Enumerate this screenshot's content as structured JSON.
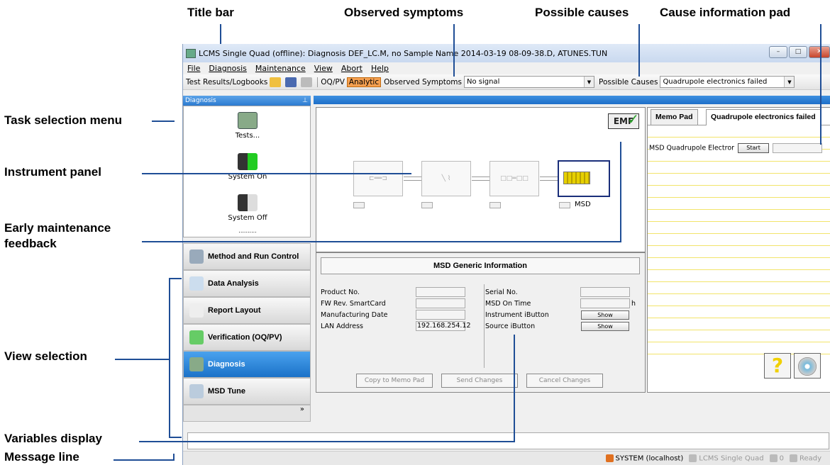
{
  "callouts": {
    "title_bar": "Title bar",
    "observed_symptoms": "Observed symptoms",
    "possible_causes": "Possible causes",
    "cause_info_pad": "Cause information pad",
    "task_selection_menu": "Task selection menu",
    "instrument_panel": "Instrument panel",
    "early_maintenance_1": "Early maintenance",
    "early_maintenance_2": "feedback",
    "view_selection": "View selection",
    "variables_display": "Variables display",
    "message_line": "Message line"
  },
  "window": {
    "title": "LCMS Single Quad (offline): Diagnosis DEF_LC.M, no Sample Name 2014-03-19 08-09-38.D, ATUNES.TUN"
  },
  "menu": [
    "File",
    "Diagnosis",
    "Maintenance",
    "View",
    "Abort",
    "Help"
  ],
  "toolbar": {
    "test_results": "Test Results/Logbooks",
    "oqpv": "OQ/PV",
    "analytic": "Analytic",
    "observed_symptoms_label": "Observed Symptoms",
    "observed_symptoms_value": "No signal",
    "possible_causes_label": "Possible Causes",
    "possible_causes_value": "Quadrupole electronics failed"
  },
  "left": {
    "header": "Diagnosis",
    "tasks": [
      "Tests...",
      "System On",
      "System Off"
    ],
    "dots": "..........",
    "views": [
      "Method and Run Control",
      "Data Analysis",
      "Report Layout",
      "Verification (OQ/PV)",
      "Diagnosis",
      "MSD Tune"
    ],
    "active_view": "Diagnosis",
    "more": "»"
  },
  "instrument": {
    "evm_label": "EMF",
    "msd_label": "MSD"
  },
  "generic_info": {
    "title": "MSD Generic Information",
    "left_fields": [
      {
        "label": "Product No.",
        "value": ""
      },
      {
        "label": "FW Rev. SmartCard",
        "value": ""
      },
      {
        "label": "Manufacturing Date",
        "value": ""
      },
      {
        "label": "LAN Address",
        "value": "192.168.254.12"
      }
    ],
    "right_fields": [
      {
        "label": "Serial No.",
        "value": ""
      },
      {
        "label": "MSD On Time",
        "value": "",
        "unit": "h"
      },
      {
        "label": "Instrument iButton",
        "button": "Show"
      },
      {
        "label": "Source iButton",
        "button": "Show"
      }
    ],
    "buttons": [
      "Copy to Memo Pad",
      "Send Changes",
      "Cancel Changes"
    ]
  },
  "right_pane": {
    "tabs": [
      "Memo Pad",
      "Quadrupole electronics failed"
    ],
    "row_label": "MSD Quadrupole Electror",
    "start_button": "Start",
    "help_glyph": "?"
  },
  "status": {
    "user": "SYSTEM (localhost)",
    "instrument": "LCMS Single Quad",
    "count": "0",
    "state": "Ready"
  }
}
